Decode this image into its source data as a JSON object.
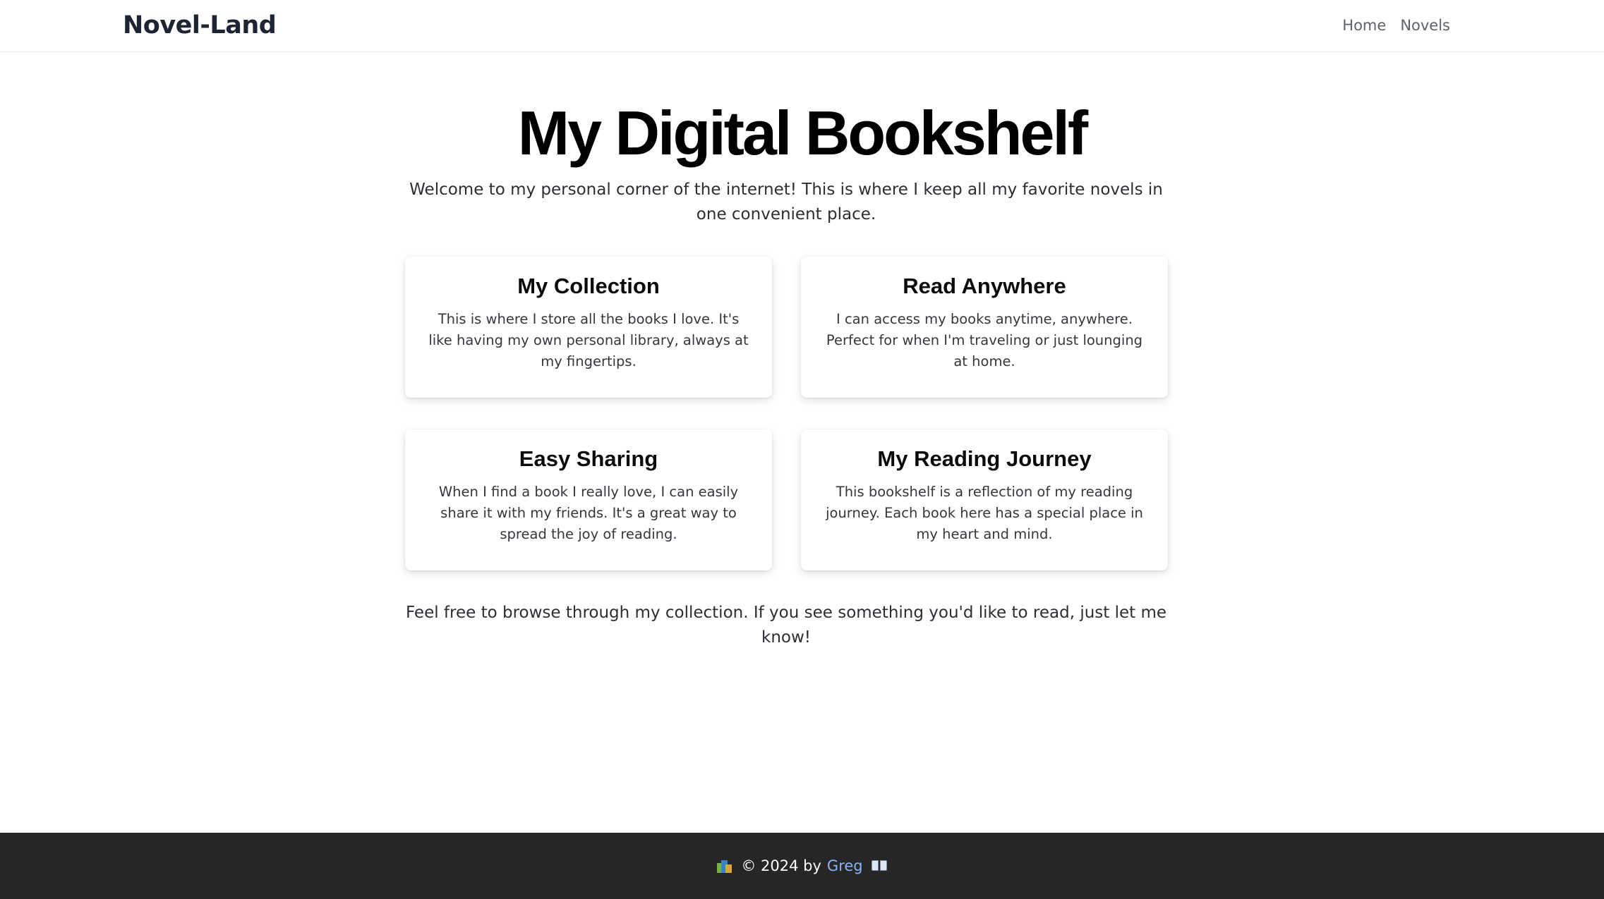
{
  "navbar": {
    "brand": "Novel-Land",
    "links": [
      {
        "label": "Home"
      },
      {
        "label": "Novels"
      }
    ]
  },
  "hero": {
    "title": "My Digital Bookshelf",
    "intro": "Welcome to my personal corner of the internet! This is where I keep all my favorite novels in one convenient place."
  },
  "cards": [
    {
      "title": "My Collection",
      "text": "This is where I store all the books I love. It's like having my own personal library, always at my fingertips."
    },
    {
      "title": "Read Anywhere",
      "text": "I can access my books anytime, anywhere. Perfect for when I'm traveling or just lounging at home."
    },
    {
      "title": "Easy Sharing",
      "text": "When I find a book I really love, I can easily share it with my friends. It's a great way to spread the joy of reading."
    },
    {
      "title": "My Reading Journey",
      "text": "This bookshelf is a reflection of my reading journey. Each book here has a special place in my heart and mind."
    }
  ],
  "outro": "Feel free to browse through my collection. If you see something you'd like to read, just let me know!",
  "footer": {
    "leading_icon": "books-icon",
    "copyright": "© 2024 by",
    "author_link": "Greg",
    "trailing_icon": "open-book-icon"
  },
  "colors": {
    "footer_background": "#262626",
    "link": "#8ab4f8",
    "brand_text": "#1d2532"
  }
}
